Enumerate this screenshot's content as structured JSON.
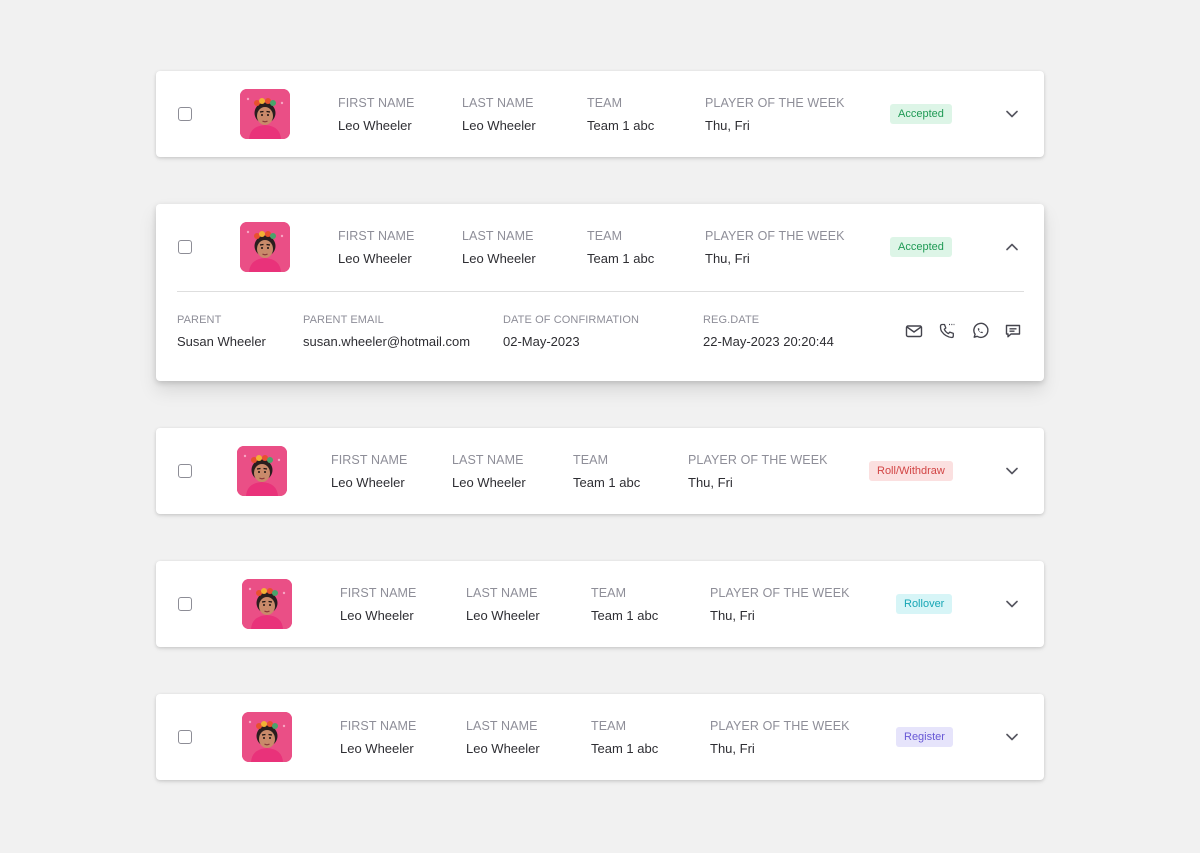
{
  "labels": {
    "first_name": "FIRST NAME",
    "last_name": "LAST NAME",
    "team": "TEAM",
    "player_of_week": "PLAYER OF THE WEEK"
  },
  "rows": [
    {
      "first_name": "Leo Wheeler",
      "last_name": "Leo Wheeler",
      "team": "Team 1 abc",
      "player_of_week": "Thu, Fri",
      "status": "Accepted",
      "expanded": false
    },
    {
      "first_name": "Leo Wheeler",
      "last_name": "Leo Wheeler",
      "team": "Team 1 abc",
      "player_of_week": "Thu, Fri",
      "status": "Accepted",
      "expanded": true
    },
    {
      "first_name": "Leo Wheeler",
      "last_name": "Leo Wheeler",
      "team": "Team 1 abc",
      "player_of_week": "Thu, Fri",
      "status": "Roll/Withdraw",
      "expanded": false
    },
    {
      "first_name": "Leo Wheeler",
      "last_name": "Leo Wheeler",
      "team": "Team 1 abc",
      "player_of_week": "Thu, Fri",
      "status": "Rollover",
      "expanded": false
    },
    {
      "first_name": "Leo Wheeler",
      "last_name": "Leo Wheeler",
      "team": "Team 1 abc",
      "player_of_week": "Thu, Fri",
      "status": "Register",
      "expanded": false
    }
  ],
  "details": {
    "parent_label": "PARENT",
    "parent": "Susan Wheeler",
    "parent_email_label": "PARENT EMAIL",
    "parent_email": "susan.wheeler@hotmail.com",
    "confirmation_label": "DATE OF CONFIRMATION",
    "confirmation": "02-May-2023",
    "reg_date_label": "REG.DATE",
    "reg_date": "22-May-2023 20:20:44",
    "actions": [
      "mail-icon",
      "phone-icon",
      "whatsapp-icon",
      "message-icon"
    ]
  },
  "colors": {
    "accepted": "#1f9a55",
    "roll_withdraw": "#d24545",
    "rollover": "#17a6b5",
    "register": "#6858d6",
    "avatar_bg": "#ea4f86"
  }
}
